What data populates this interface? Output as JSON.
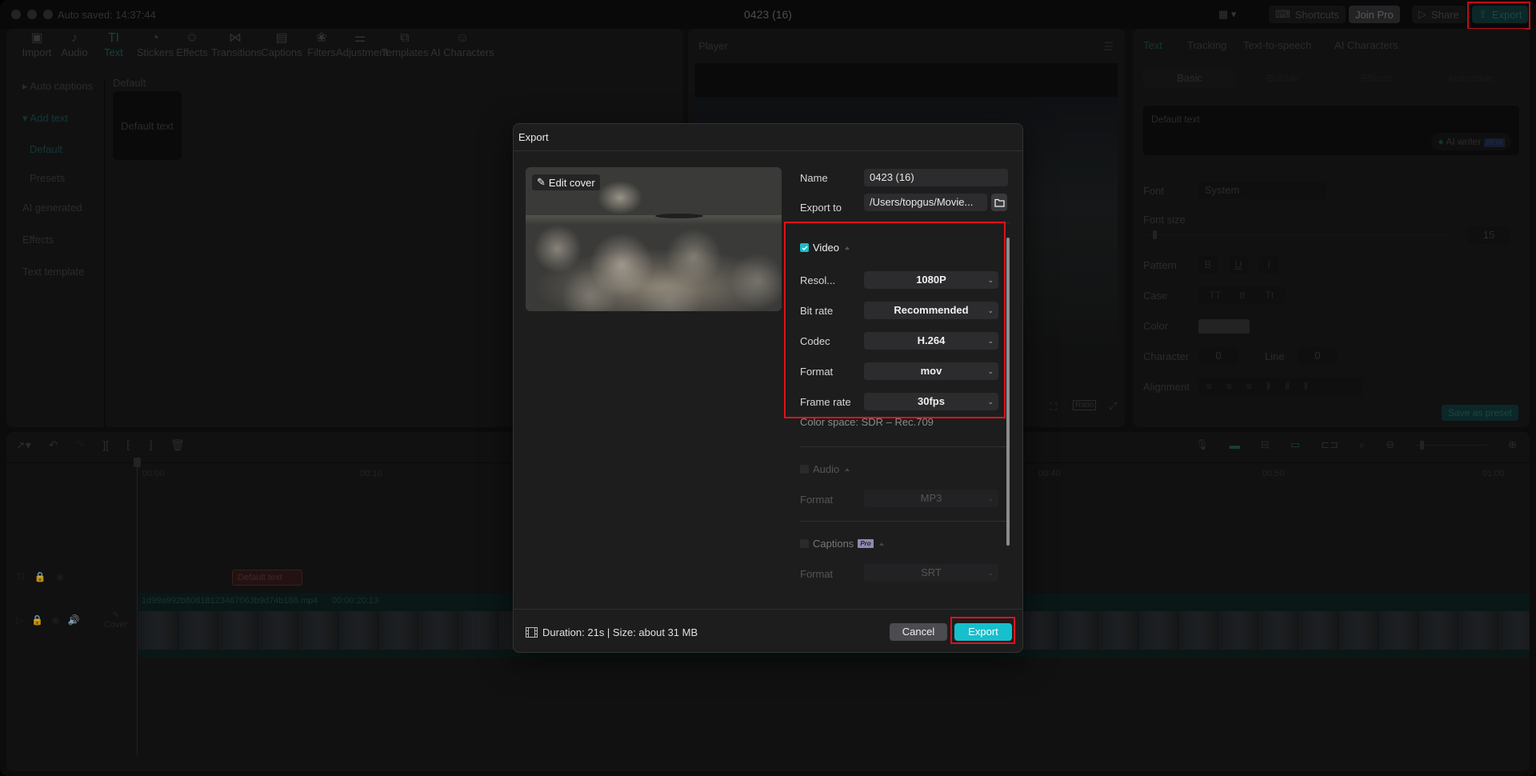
{
  "window": {
    "title": "0423 (16)",
    "autosave": "Auto saved: 14:37:44",
    "buttons": {
      "shortcuts": "Shortcuts",
      "join_pro": "Join Pro",
      "share": "Share",
      "export": "Export"
    }
  },
  "toolbar": {
    "items": [
      {
        "label": "Import",
        "icon": "import-icon"
      },
      {
        "label": "Audio",
        "icon": "audio-icon"
      },
      {
        "label": "Text",
        "icon": "text-icon",
        "active": true
      },
      {
        "label": "Stickers",
        "icon": "stickers-icon"
      },
      {
        "label": "Effects",
        "icon": "effects-icon"
      },
      {
        "label": "Transitions",
        "icon": "transitions-icon"
      },
      {
        "label": "Captions",
        "icon": "captions-icon"
      },
      {
        "label": "Filters",
        "icon": "filters-icon"
      },
      {
        "label": "Adjustment",
        "icon": "adjustment-icon"
      },
      {
        "label": "Templates",
        "icon": "templates-icon"
      },
      {
        "label": "AI Characters",
        "icon": "ai-characters-icon"
      }
    ]
  },
  "text_sidebar": {
    "items": [
      "Auto captions",
      "Add text",
      "Default",
      "Presets",
      "AI generated",
      "Effects",
      "Text template"
    ],
    "section_title": "Default",
    "preset_card": "Default text"
  },
  "player": {
    "title": "Player",
    "ratio_label": "Ratio"
  },
  "inspector": {
    "tabs": [
      "Text",
      "Tracking",
      "Text-to-speech",
      "AI Characters"
    ],
    "subtabs": [
      "Basic",
      "Bubble",
      "Effects",
      "Animation"
    ],
    "text_value": "Default text",
    "ai_writer": "AI writer",
    "beta": "BETA",
    "font_label": "Font",
    "font_value": "System",
    "font_size_label": "Font size",
    "font_size_value": "15",
    "pattern_label": "Pattern",
    "pattern": [
      "B",
      "U",
      "I"
    ],
    "case_label": "Case",
    "case": [
      "TT",
      "tt",
      "Tt"
    ],
    "color_label": "Color",
    "character_label": "Character",
    "character_value": "0",
    "line_label": "Line",
    "line_value": "0",
    "alignment_label": "Alignment",
    "save_preset": "Save as preset"
  },
  "timeline": {
    "ticks": [
      "00:00",
      "00:10",
      "00:40",
      "00:50",
      "01:00"
    ],
    "text_clip": "Default text",
    "video_clip_name": "1d99a992b80818123467063b9d74b188.mp4",
    "video_clip_duration": "00:00:20:13",
    "cover_label": "Cover"
  },
  "export_dialog": {
    "title": "Export",
    "edit_cover": "Edit cover",
    "name_label": "Name",
    "name_value": "0423 (16)",
    "export_to_label": "Export to",
    "export_to_value": "/Users/topgus/Movie...",
    "video": {
      "label": "Video",
      "checked": true,
      "rows": [
        {
          "label": "Resol...",
          "value": "1080P"
        },
        {
          "label": "Bit rate",
          "value": "Recommended"
        },
        {
          "label": "Codec",
          "value": "H.264"
        },
        {
          "label": "Format",
          "value": "mov"
        },
        {
          "label": "Frame rate",
          "value": "30fps"
        }
      ],
      "color_space": "Color space: SDR – Rec.709"
    },
    "audio": {
      "label": "Audio",
      "checked": false,
      "format_label": "Format",
      "format_value": "MP3"
    },
    "captions": {
      "label": "Captions",
      "badge": "Pro",
      "checked": false,
      "format_label": "Format",
      "format_value": "SRT"
    },
    "info": "Duration: 21s | Size: about 31 MB",
    "cancel": "Cancel",
    "export": "Export"
  },
  "colors": {
    "accent": "#16bfcc",
    "highlight": "#e0101c"
  }
}
